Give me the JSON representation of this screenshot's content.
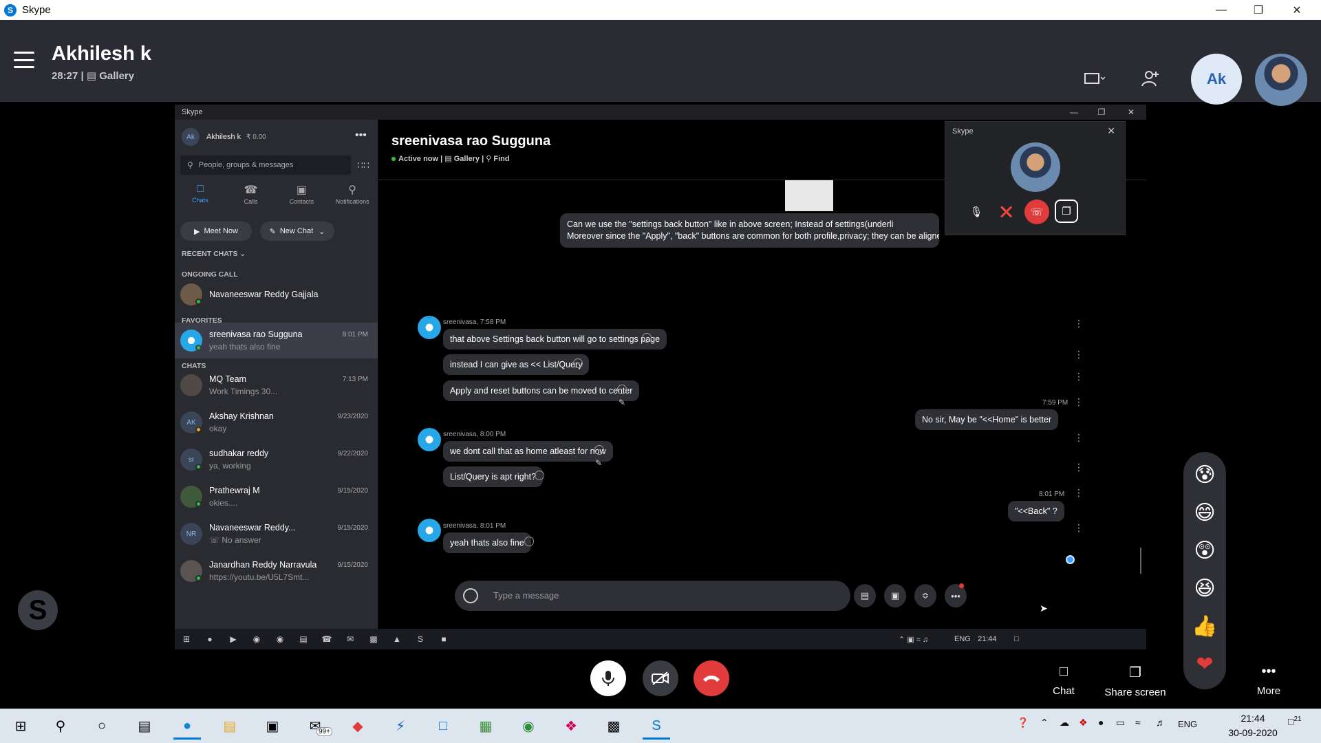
{
  "window": {
    "title": "Skype"
  },
  "call": {
    "name": "Akhilesh k",
    "duration": "28:27",
    "view_label": "Gallery",
    "avatar_initials": "Ak"
  },
  "shared_window": {
    "title": "Skype",
    "profile": {
      "initials": "Ak",
      "name": "Akhilesh k",
      "credit": "₹ 0.00"
    },
    "search_placeholder": "People, groups & messages",
    "tabs": [
      "Chats",
      "Calls",
      "Contacts",
      "Notifications"
    ],
    "meet_now": "Meet Now",
    "new_chat": "New Chat",
    "sections": {
      "recent": "RECENT CHATS",
      "ongoing": "ONGOING CALL",
      "favorites": "FAVORITES",
      "chats": "CHATS"
    },
    "ongoing_call": {
      "name": "Navaneeswar Reddy Gajjala"
    },
    "favorites": [
      {
        "name": "sreenivasa rao Sugguna",
        "preview": "yeah thats also fine",
        "time": "8:01 PM"
      }
    ],
    "chats": [
      {
        "name": "MQ Team",
        "preview": "Work Timings 30...",
        "time": "7:13 PM",
        "initials": ""
      },
      {
        "name": "Akshay Krishnan",
        "preview": "okay",
        "time": "9/23/2020",
        "initials": "AK"
      },
      {
        "name": "sudhakar reddy",
        "preview": "ya, working",
        "time": "9/22/2020",
        "initials": "sr"
      },
      {
        "name": "Prathewraj M",
        "preview": "okies....",
        "time": "9/15/2020",
        "initials": ""
      },
      {
        "name": "Navaneeswar Reddy...",
        "preview": "No answer",
        "time": "9/15/2020",
        "initials": "NR"
      },
      {
        "name": "Janardhan Reddy Narravula",
        "preview": "https://youtu.be/U5L7Smt...",
        "time": "9/15/2020",
        "initials": ""
      }
    ],
    "conversation": {
      "title": "sreenivasa rao Sugguna",
      "status": "Active now",
      "gallery": "Gallery",
      "find": "Find",
      "messages": {
        "m1_line1": "Can we use the \"settings back button\" like in above screen; Instead of settings(underli",
        "m1_line2": "Moreover since the \"Apply\", \"back\" buttons are common for both profile,privacy; they can be aligned center i guess",
        "meta1": "sreenivasa, 7:58 PM",
        "r1": "that above Settings back button will go to settings page",
        "r2": "instead I can give as << List/Query",
        "r3": "Apply and reset buttons can be moved to center",
        "meta2": "7:59 PM",
        "m2": "No sir, May be \"<<Home\" is better",
        "meta3": "sreenivasa, 8:00 PM",
        "r4": "we dont call that as home atleast for now",
        "r5": "List/Query is apt right?",
        "meta4": "8:01 PM",
        "m3": "\"<<Back\" ?",
        "meta5": "sreenivasa, 8:01 PM",
        "r6": "yeah thats also fine"
      },
      "composer_placeholder": "Type a message"
    },
    "mini_call_title": "Skype",
    "taskbar_lang": "ENG",
    "taskbar_time": "21:44"
  },
  "controls": {
    "chat": "Chat",
    "share_screen": "Share screen",
    "more": "More"
  },
  "taskbar": {
    "badge": "99+",
    "lang": "ENG",
    "time": "21:44",
    "date": "30-09-2020",
    "notifications": "21"
  },
  "colors": {
    "header_bg": "#2b2c33",
    "accent": "#0078d4",
    "hangup": "#e23b3b",
    "online": "#2fc045"
  }
}
